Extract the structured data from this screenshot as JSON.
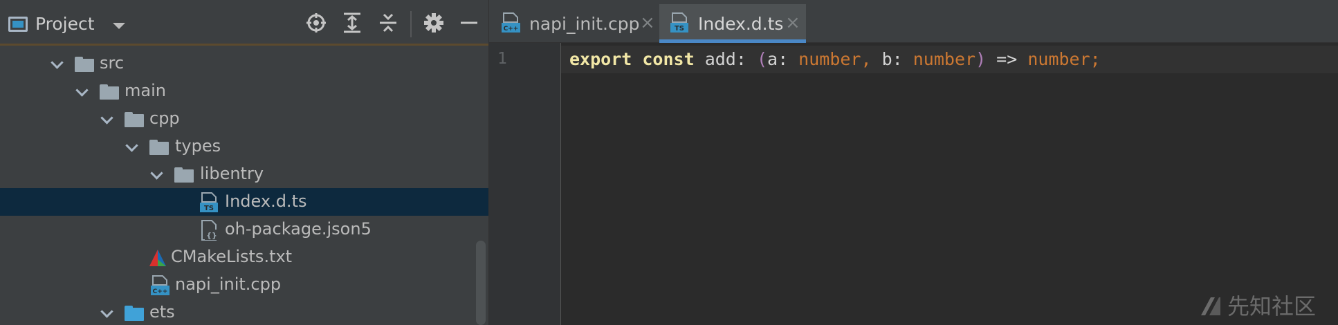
{
  "project": {
    "title": "Project",
    "tree": [
      {
        "label": "src",
        "kind": "folder"
      },
      {
        "label": "main",
        "kind": "folder"
      },
      {
        "label": "cpp",
        "kind": "folder"
      },
      {
        "label": "types",
        "kind": "folder"
      },
      {
        "label": "libentry",
        "kind": "folder"
      },
      {
        "label": "Index.d.ts",
        "kind": "ts-file",
        "badge": "TS",
        "selected": true
      },
      {
        "label": "oh-package.json5",
        "kind": "json-file",
        "badge": "{}"
      },
      {
        "label": "CMakeLists.txt",
        "kind": "cmake-file"
      },
      {
        "label": "napi_init.cpp",
        "kind": "cpp-file",
        "badge": "C++"
      },
      {
        "label": "ets",
        "kind": "folder-blue"
      }
    ],
    "header_icons": [
      "locate-icon",
      "expand-all-icon",
      "collapse-all-icon",
      "gear-icon",
      "minimize-icon"
    ]
  },
  "editor": {
    "tabs": [
      {
        "label": "napi_init.cpp",
        "badge": "C++",
        "close": "×",
        "active": false
      },
      {
        "label": "Index.d.ts",
        "badge": "TS",
        "close": "×",
        "active": true
      }
    ],
    "line_number": "1",
    "code": {
      "kw_export": "export",
      "kw_const": "const",
      "name": " add: ",
      "paren_open": "(",
      "param_a": "a: ",
      "type_a": "number",
      "comma": ", ",
      "param_b": "b: ",
      "type_b": "number",
      "paren_close": ")",
      "arrow": " => ",
      "type_ret": "number",
      "semicolon": ";"
    }
  },
  "watermark": "先知社区",
  "colors": {
    "selected_row": "#0d293e",
    "active_tab_underline": "#4a88c7",
    "folder_grey": "#9aa7b0",
    "folder_blue": "#40a2d8"
  }
}
